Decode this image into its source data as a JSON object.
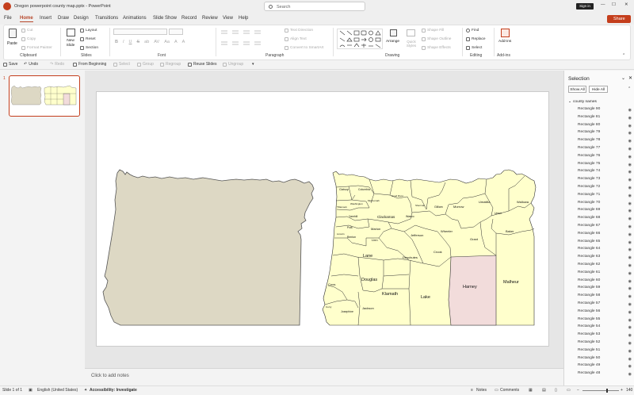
{
  "titlebar": {
    "doc_title": "Oregon powerpoint county map.pptx  -  PowerPoint",
    "search_placeholder": "Search",
    "sign_in": "Sign in"
  },
  "tabs": [
    "File",
    "Home",
    "Insert",
    "Draw",
    "Design",
    "Transitions",
    "Animations",
    "Slide Show",
    "Record",
    "Review",
    "View",
    "Help"
  ],
  "share_label": "Share",
  "ribbon": {
    "groups": {
      "clipboard": "Clipboard",
      "slides": "Slides",
      "font": "Font",
      "paragraph": "Paragraph",
      "drawing": "Drawing",
      "editing": "Editing",
      "addins": "Add-ins"
    },
    "paste": "Paste",
    "cut": "Cut",
    "copy": "Copy",
    "format_painter": "Format Painter",
    "new_slide": "New Slide",
    "layout": "Layout",
    "reset": "Reset",
    "section": "Section",
    "text_direction": "Text Direction",
    "align_text": "Align Text",
    "convert_smartart": "Convert to SmartArt",
    "arrange": "Arrange",
    "quick_styles": "Quick Styles",
    "shape_fill": "Shape Fill",
    "shape_outline": "Shape Outline",
    "shape_effects": "Shape Effects",
    "find": "Find",
    "replace": "Replace",
    "select": "Select",
    "addins_btn": "Add-ins",
    "font_buttons": [
      "B",
      "I",
      "U",
      "S",
      "ab",
      "AV",
      "Aa",
      "A",
      "A"
    ]
  },
  "qat": {
    "save": "Save",
    "undo": "Undo",
    "redo": "Redo",
    "from_beginning": "From Beginning",
    "select_btn": "Select",
    "group": "Group",
    "regroup": "Regroup",
    "reuse_slides": "Reuse Slides",
    "ungroup": "Ungroup"
  },
  "thumbnail": {
    "number": "1"
  },
  "notes_placeholder": "Click to add notes",
  "selection_pane": {
    "title": "Selection",
    "show_all": "Show All",
    "hide_all": "Hide All",
    "group_name": "county names",
    "items": [
      "Rectangle 90",
      "Rectangle 81",
      "Rectangle 80",
      "Rectangle 79",
      "Rectangle 78",
      "Rectangle 77",
      "Rectangle 76",
      "Rectangle 75",
      "Rectangle 74",
      "Rectangle 73",
      "Rectangle 72",
      "Rectangle 71",
      "Rectangle 70",
      "Rectangle 69",
      "Rectangle 68",
      "Rectangle 67",
      "Rectangle 66",
      "Rectangle 65",
      "Rectangle 64",
      "Rectangle 63",
      "Rectangle 62",
      "Rectangle 61",
      "Rectangle 60",
      "Rectangle 59",
      "Rectangle 58",
      "Rectangle 57",
      "Rectangle 56",
      "Rectangle 55",
      "Rectangle 54",
      "Rectangle 53",
      "Rectangle 52",
      "Rectangle 51",
      "Rectangle 50",
      "Rectangle 49",
      "Rectangle 48"
    ]
  },
  "counties": {
    "lane": "Lane",
    "douglas": "Douglas",
    "coos": "Coos",
    "curry": "Curry",
    "josephine": "Josephine",
    "jackson": "Jackson",
    "klamath": "Klamath",
    "lake": "Lake",
    "harney": "Harney",
    "malheur": "Malheur",
    "deschutes": "Deschutes",
    "crook": "Crook",
    "jefferson": "Jefferson",
    "wheeler": "Wheeler",
    "grant": "Grant",
    "baker": "Baker",
    "union": "Union",
    "wallowa": "Wallowa",
    "umatilla": "Umatilla",
    "morrow": "Morrow",
    "gilliam": "Gilliam",
    "sherman": "Sherman",
    "wasco": "Wasco",
    "hood_river": "Hood River",
    "clackamas": "Clackamas",
    "marion": "Marion",
    "linn": "Linn",
    "benton": "Benton",
    "polk": "Polk",
    "lincoln": "Lincoln",
    "yamhill": "Yamhill",
    "tillamook": "Tillamook",
    "washington": "Washington",
    "multnomah": "Multnomah",
    "columbia": "Columbia",
    "clatsop": "Clatsop"
  },
  "status": {
    "slide_of": "Slide 1 of 1",
    "language": "English (United States)",
    "accessibility": "Accessibility: Investigate",
    "notes": "Notes",
    "comments": "Comments",
    "zoom": "140"
  },
  "colors": {
    "accent": "#b7472a",
    "county_fill": "#ffffcc",
    "harney_fill": "#f2dcdb",
    "silhouette_fill": "#ddd8c4"
  }
}
